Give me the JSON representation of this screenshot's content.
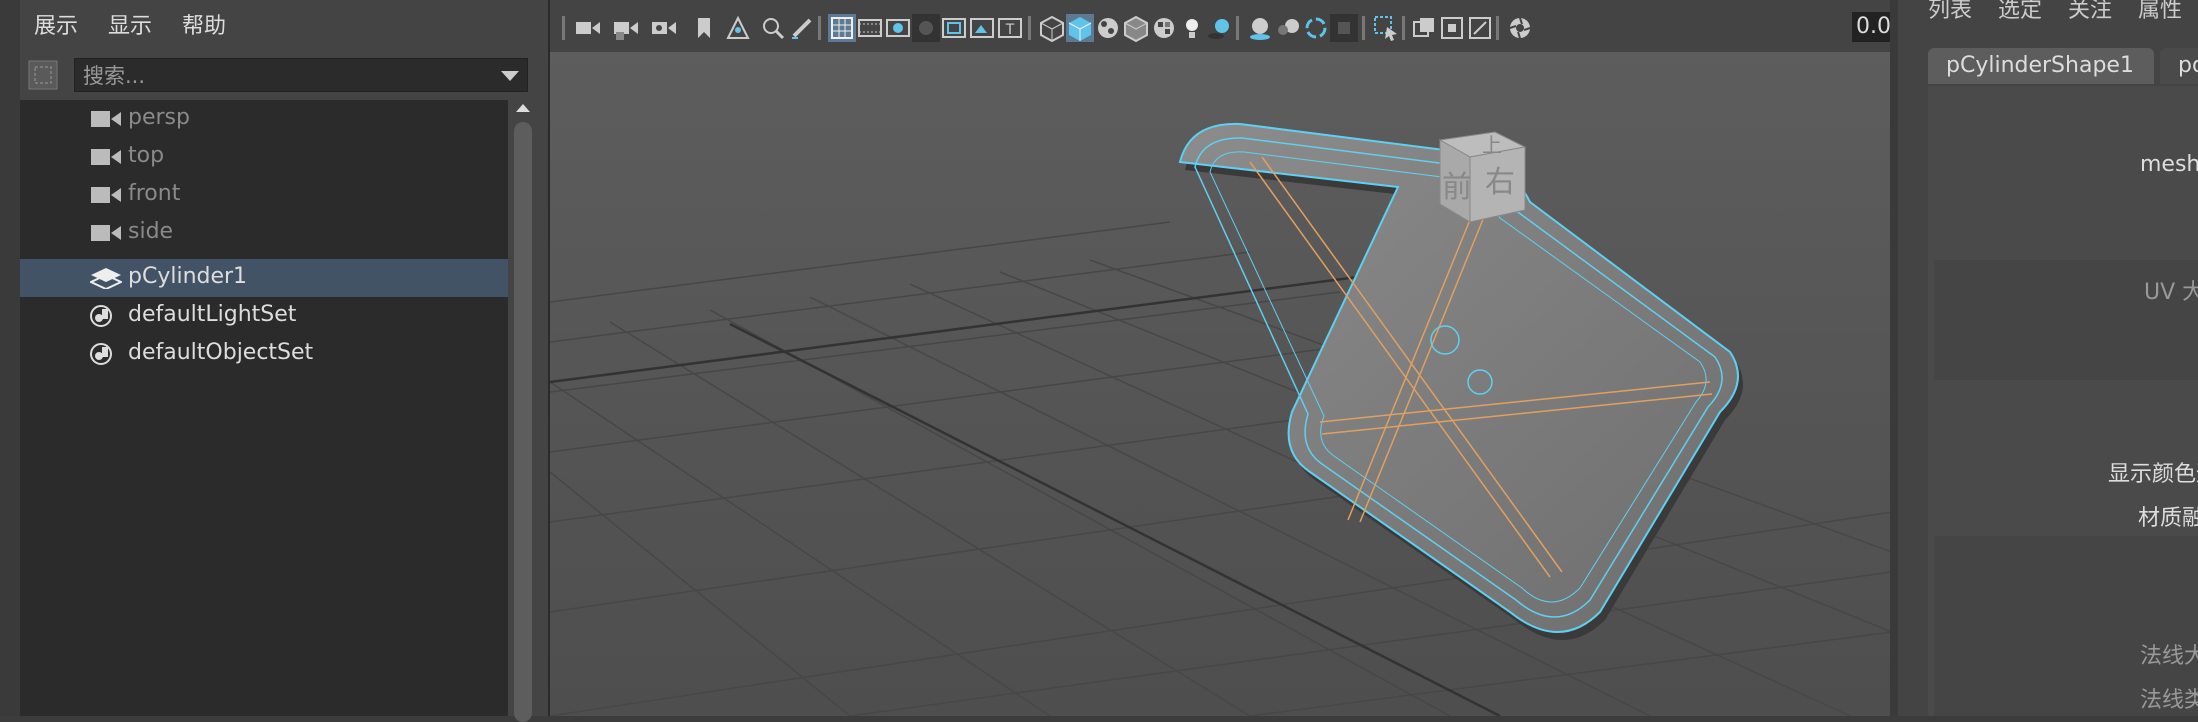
{
  "outliner": {
    "menu": [
      "展示",
      "显示",
      "帮助"
    ],
    "search": {
      "placeholder": "搜索..."
    },
    "items": [
      {
        "label": "persp",
        "icon": "camera-icon",
        "dim": true
      },
      {
        "label": "top",
        "icon": "camera-icon",
        "dim": true
      },
      {
        "label": "front",
        "icon": "camera-icon",
        "dim": true
      },
      {
        "label": "side",
        "icon": "camera-icon",
        "dim": true
      },
      {
        "label": "pCylinder1",
        "icon": "transform-icon",
        "selected": true
      },
      {
        "label": "defaultLightSet",
        "icon": "set-icon"
      },
      {
        "label": "defaultObjectSet",
        "icon": "set-icon"
      }
    ]
  },
  "viewport": {
    "zoom_value": "0.00",
    "viewcube": {
      "top": "上",
      "front": "前",
      "right": "右"
    },
    "colors": {
      "background": "#555555",
      "wire": "#5fd0f0",
      "wire_orange": "#e0a060"
    }
  },
  "attribute_editor": {
    "menu": [
      "列表",
      "选定",
      "关注",
      "属性"
    ],
    "tabs": [
      "pCylinderShape1",
      "po"
    ],
    "labels": [
      "mesh",
      "UV 大",
      "显示颜色通",
      "材质融",
      "法线大",
      "法线类"
    ]
  }
}
